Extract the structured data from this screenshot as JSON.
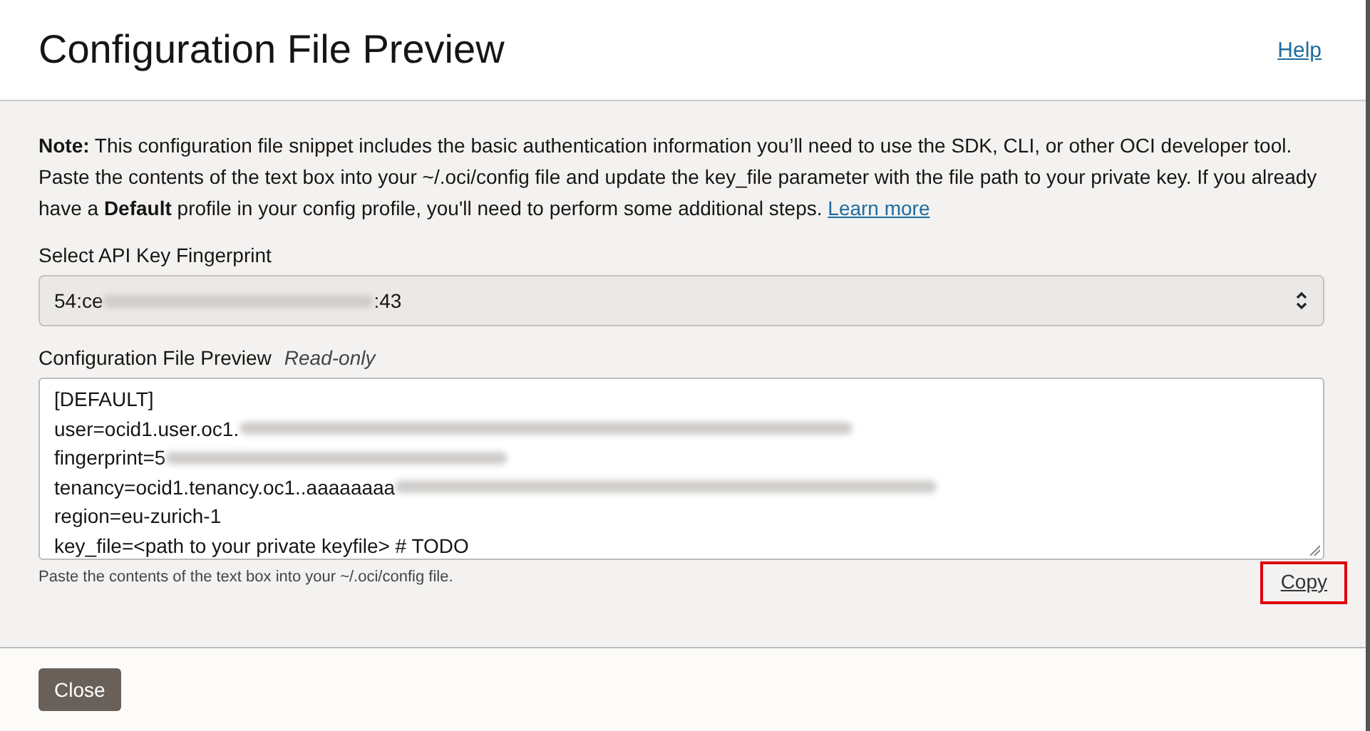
{
  "dialog": {
    "title": "Configuration File Preview",
    "help_link": "Help"
  },
  "note": {
    "text": "**Note:** This configuration file snippet includes the basic authentication information you’ll need to use the SDK, CLI, or other OCI developer tool. Paste the contents of the text box into your ~/.oci/config file and update the key_file parameter with the file path to your private key. If you already have a **Default** profile in your config profile, you'll need to perform some additional steps.",
    "link": "Learn more"
  },
  "fingerprint_select": {
    "label": "Select API Key Fingerprint",
    "value_start": "54:ce",
    "value_end": ":43",
    "redacted": true
  },
  "preview": {
    "label": "Configuration File Preview",
    "badge": "Read-only",
    "lines": [
      {
        "text": "[DEFAULT]",
        "redacted": false
      },
      {
        "text": "user=ocid1.user.oc1.",
        "redacted": true
      },
      {
        "text": "fingerprint=5",
        "redacted": true
      },
      {
        "text": "tenancy=ocid1.tenancy.oc1..aaaaaaaa",
        "redacted": true
      },
      {
        "text": "region=eu-zurich-1",
        "redacted": false
      },
      {
        "text": "key_file=<path to your private keyfile> # TODO",
        "redacted": false
      }
    ],
    "help_text": "Paste the contents of the text box into your ~/.oci/config file.",
    "copy_link": {
      "label": "Copy",
      "highlighted": true
    }
  },
  "footer": {
    "buttons": [
      "Close"
    ]
  }
}
